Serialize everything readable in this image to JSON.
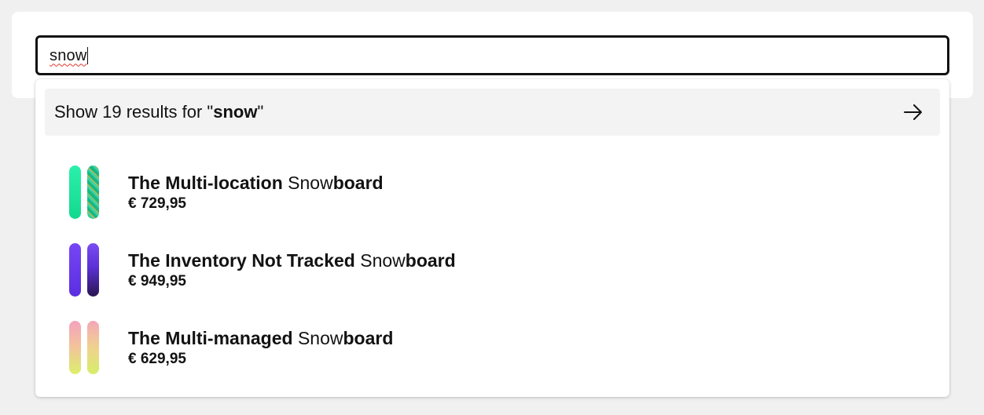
{
  "search": {
    "value": "snow"
  },
  "dropdown": {
    "show_results": {
      "prefix": "Show 19 results for \"",
      "term": "snow",
      "suffix": "\""
    },
    "products": [
      {
        "title_bold": "The Multi-location ",
        "title_match": "Snow",
        "title_rest": "board",
        "price": "€ 729,95",
        "colors": [
          "#1de9a0",
          "#17b884"
        ]
      },
      {
        "title_bold": "The Inventory Not Tracked ",
        "title_match": "Snow",
        "title_rest": "board",
        "price": "€ 949,95",
        "colors": [
          "#6b3cf0",
          "#3a1d78"
        ]
      },
      {
        "title_bold": "The Multi-managed ",
        "title_match": "Snow",
        "title_rest": "board",
        "price": "€ 629,95",
        "colors": [
          "#f3a6b8",
          "#d9ee6a"
        ]
      }
    ]
  }
}
